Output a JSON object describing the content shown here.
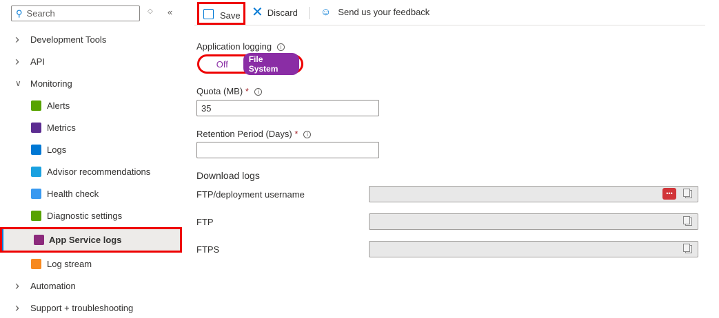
{
  "sidebar": {
    "search_placeholder": "Search",
    "items": [
      {
        "label": "Development Tools",
        "type": "group"
      },
      {
        "label": "API",
        "type": "group"
      },
      {
        "label": "Monitoring",
        "type": "group-open"
      },
      {
        "label": "Alerts",
        "icon": "alert-icon",
        "color": "#57a300"
      },
      {
        "label": "Metrics",
        "icon": "metrics-icon",
        "color": "#5c2d91"
      },
      {
        "label": "Logs",
        "icon": "logs-icon",
        "color": "#0078d4"
      },
      {
        "label": "Advisor recommendations",
        "icon": "advisor-icon",
        "color": "#1aa1e0"
      },
      {
        "label": "Health check",
        "icon": "health-icon",
        "color": "#3999f0"
      },
      {
        "label": "Diagnostic settings",
        "icon": "diagnostic-icon",
        "color": "#57a300"
      },
      {
        "label": "App Service logs",
        "icon": "app-service-logs-icon",
        "color": "#8c2a7c",
        "selected": true
      },
      {
        "label": "Log stream",
        "icon": "log-stream-icon",
        "color": "#f7891f"
      },
      {
        "label": "Automation",
        "type": "group"
      },
      {
        "label": "Support + troubleshooting",
        "type": "group"
      }
    ]
  },
  "toolbar": {
    "save": "Save",
    "discard": "Discard",
    "feedback": "Send us your feedback"
  },
  "form": {
    "app_logging_label": "Application logging",
    "toggle_off": "Off",
    "toggle_on": "File System",
    "quota_label": "Quota (MB)",
    "quota_value": "35",
    "retention_label": "Retention Period (Days)",
    "retention_value": "",
    "download_heading": "Download logs",
    "ftp_user_label": "FTP/deployment username",
    "ftp_label": "FTP",
    "ftps_label": "FTPS",
    "required_mark": "*",
    "info_glyph": "i"
  },
  "colors": {
    "accent": "#8a2da5",
    "highlight": "#e00000"
  }
}
